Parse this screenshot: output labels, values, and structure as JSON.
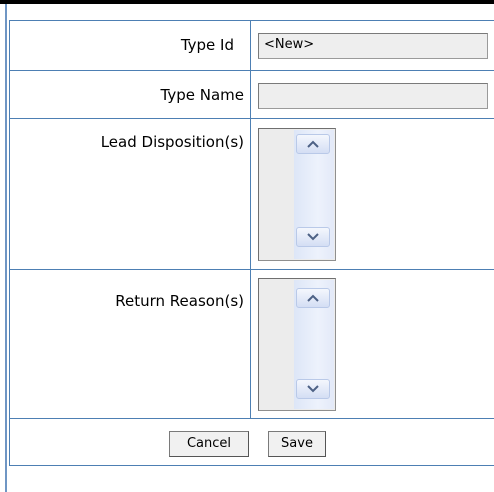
{
  "form": {
    "type_id": {
      "label": "Type Id",
      "value": "<New>"
    },
    "type_name": {
      "label": "Type Name",
      "value": ""
    },
    "lead_dispositions": {
      "label": "Lead Disposition(s)"
    },
    "return_reasons": {
      "label": "Return Reason(s)"
    }
  },
  "buttons": {
    "cancel": "Cancel",
    "save": "Save"
  },
  "icons": {
    "scroll_up": "chevron-up-icon",
    "scroll_down": "chevron-down-icon"
  },
  "colors": {
    "grid_border": "#4d7fb3",
    "scrollbar": "#dde6f7",
    "input_bg": "#eeeeee",
    "top_rule": "#000000"
  }
}
